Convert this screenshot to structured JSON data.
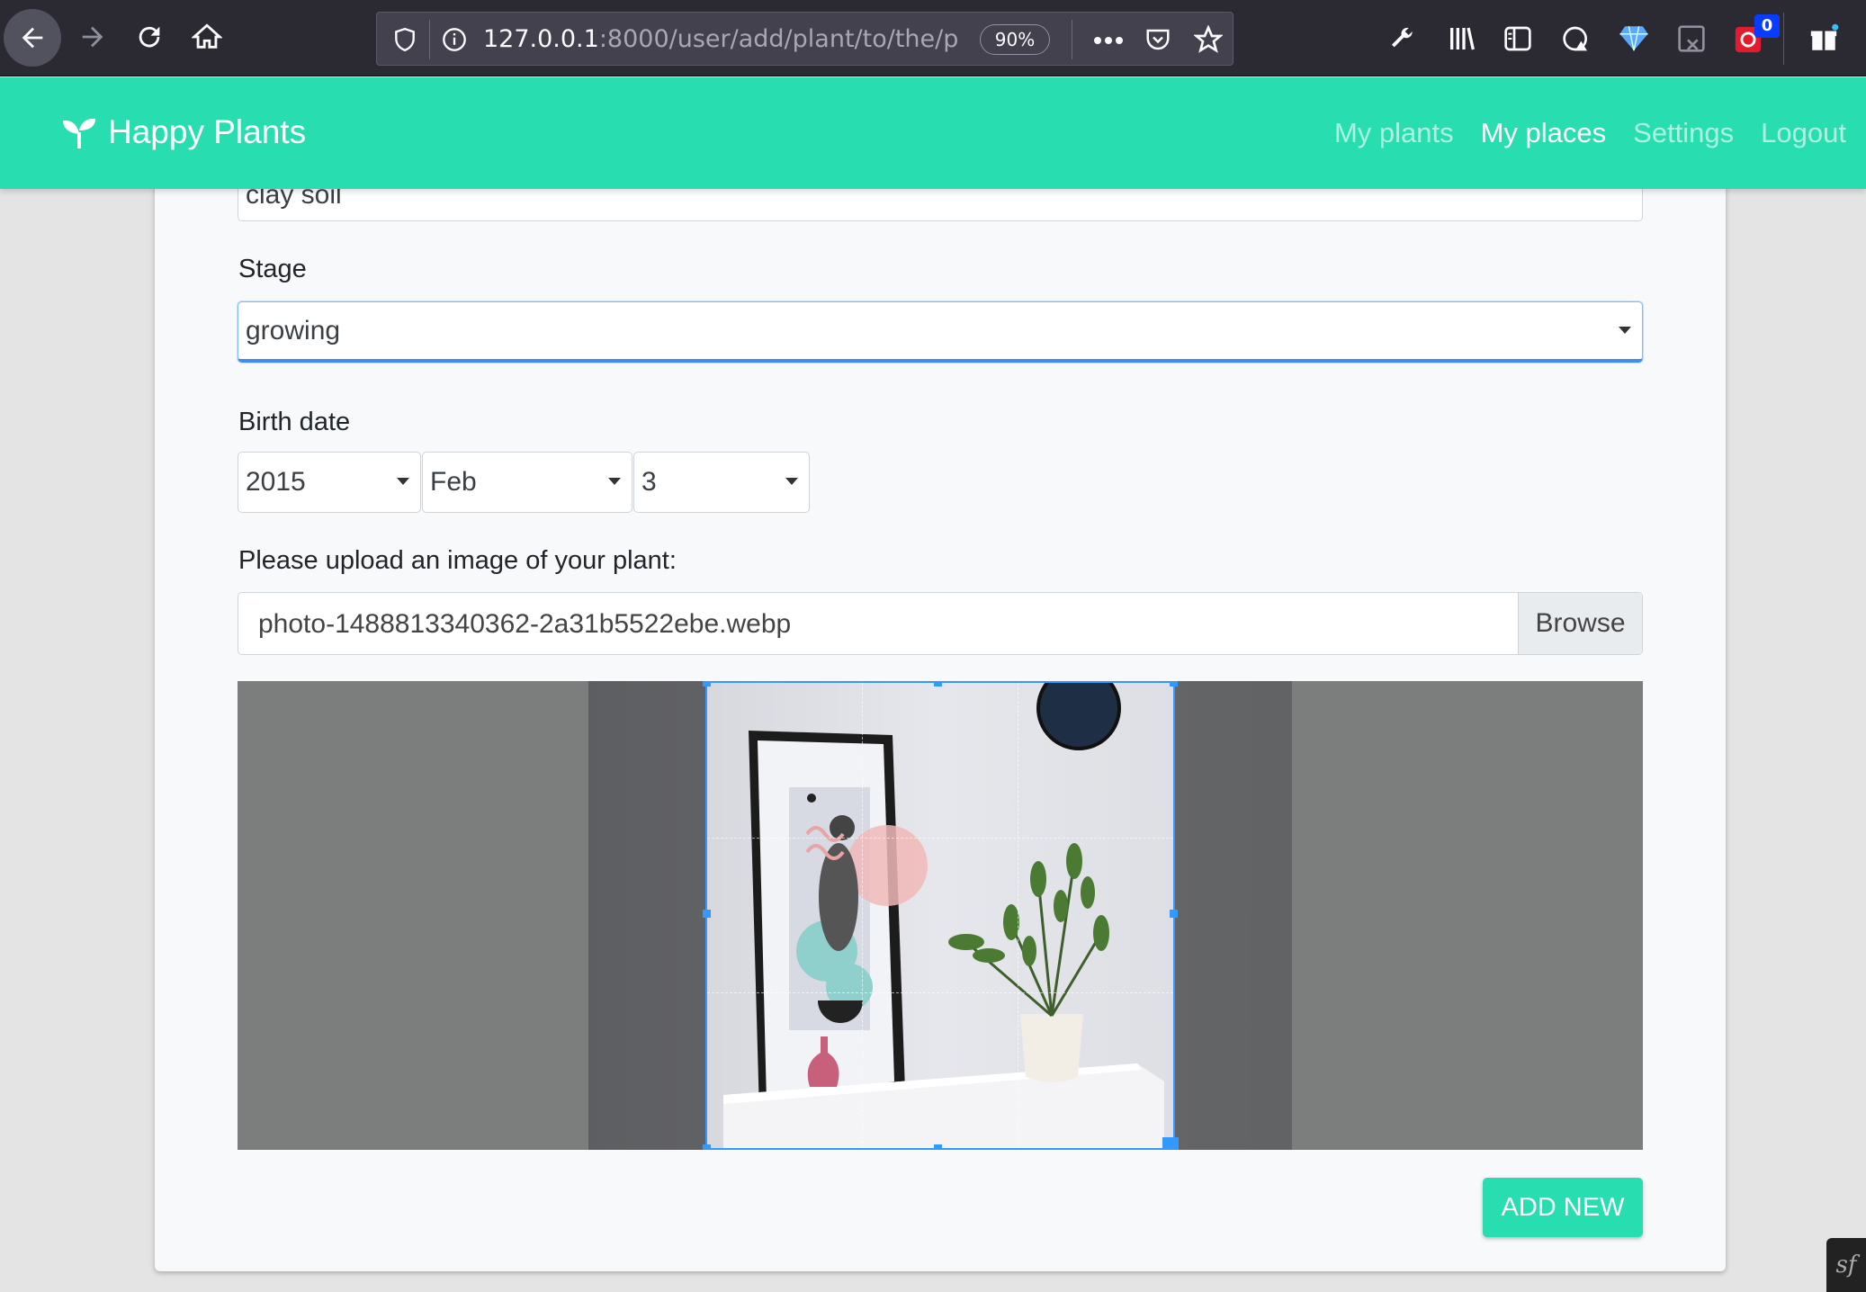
{
  "browser": {
    "url_host": "127.0.0.1",
    "url_rest": ":8000/user/add/plant/to/the/p",
    "zoom": "90%",
    "extension_badge": "0"
  },
  "navbar": {
    "brand": "Happy Plants",
    "links": [
      {
        "label": "My plants",
        "active": false
      },
      {
        "label": "My places",
        "active": true
      },
      {
        "label": "Settings",
        "active": false
      },
      {
        "label": "Logout",
        "active": false
      }
    ]
  },
  "form": {
    "soil_value": "clay soil",
    "stage_label": "Stage",
    "stage_value": "growing",
    "birth_label": "Birth date",
    "birth_year": "2015",
    "birth_month": "Feb",
    "birth_day": "3",
    "upload_label": "Please upload an image of your plant:",
    "file_name": "photo-1488813340362-2a31b5522ebe.webp",
    "browse_label": "Browse",
    "submit_label": "ADD NEW"
  },
  "colors": {
    "brand": "#28ddb0",
    "crop_accent": "#3399ff"
  },
  "debug_toolbar": "sf"
}
